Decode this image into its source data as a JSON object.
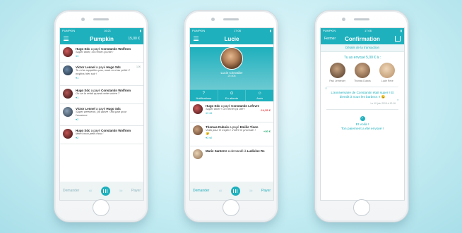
{
  "phone1": {
    "status_left": "PUMPKIN",
    "status_time": "16:21",
    "title": "Pumpkin",
    "balance": "15,00 €",
    "items": [
      {
        "who": "Hugo Sdc",
        "verb": "a payé",
        "target": "Constantin Wolfrom",
        "msg": "Super diner, on remet ça vite !",
        "meta": "♥3",
        "side": ""
      },
      {
        "who": "Victor Lennel",
        "verb": "a payé",
        "target": "Hugo Sdc",
        "msg": "Tu m'as rappelles pas, mais tu m'as prêté 2 mojitos hier soir !",
        "meta": "♥1",
        "side": "12€"
      },
      {
        "who": "Hugo Sdc",
        "verb": "a payé",
        "target": "Constantin Wolfrom",
        "msg": "On se la refait quand cette soirée ?",
        "meta": "♥1",
        "side": ""
      },
      {
        "who": "Victor Lennel",
        "verb": "a payé",
        "target": "Hugo Sdc",
        "msg": "Super weekend, j'ai adoré ! Ma part pour l'essence",
        "meta": "♥2",
        "side": ""
      },
      {
        "who": "Hugo Sdc",
        "verb": "a payé",
        "target": "Constantin Wolfrom",
        "msg": "Merci mon petit chou !",
        "meta": "♥2",
        "side": ""
      }
    ],
    "bottom_left": "Demander",
    "bottom_right": "Payer"
  },
  "phone2": {
    "status_left": "PUMPKIN",
    "status_time": "17:06",
    "title": "Lucie",
    "profile_name": "Lucie Chevalier",
    "profile_sub": "25 806",
    "tabs": [
      {
        "icon": "?",
        "label": "Notifications"
      },
      {
        "icon": "⊙",
        "label": "En attente"
      },
      {
        "icon": "☺",
        "label": "Amis"
      }
    ],
    "items": [
      {
        "who": "Hugo Sdc",
        "verb": "a payé",
        "target": "Constantin Lefevre",
        "msg": "Super dîner ! On remet ça vite !",
        "meta": "♥3  ●5",
        "side": "-14,55 €"
      },
      {
        "who": "Thomas Dubois",
        "verb": "a payé",
        "target": "Emilie Tison",
        "msg": "Voilà pour le mojito ! J'offre le prochain ! 😉",
        "meta": "♥3  ●2",
        "side": "+30 €"
      },
      {
        "who": "Marie Santerre",
        "verb": "a demandé à",
        "target": "Ludivine Rs",
        "msg": "",
        "meta": "",
        "side": ""
      }
    ],
    "bottom_left": "Demander",
    "bottom_right": "Payer"
  },
  "phone3": {
    "status_left": "PUMPKIN",
    "status_time": "17:06",
    "left_btn": "Fermer",
    "title": "Confirmation",
    "section": "Détails de la transaction",
    "amount": "Tu as envoyé 5,00 € à :",
    "people": [
      "Paul Lemercier",
      "Thomas Dubois",
      "Lucie Reve"
    ],
    "quote": "L'anniversaire de Constantin était super ! Et bientôt à nous les barbecs !! 😉",
    "quote_date": "Le 10 juin 2015 à 12:16",
    "done_line1": "Et voilà !",
    "done_line2": "Ton paiement a été envoyé !"
  }
}
